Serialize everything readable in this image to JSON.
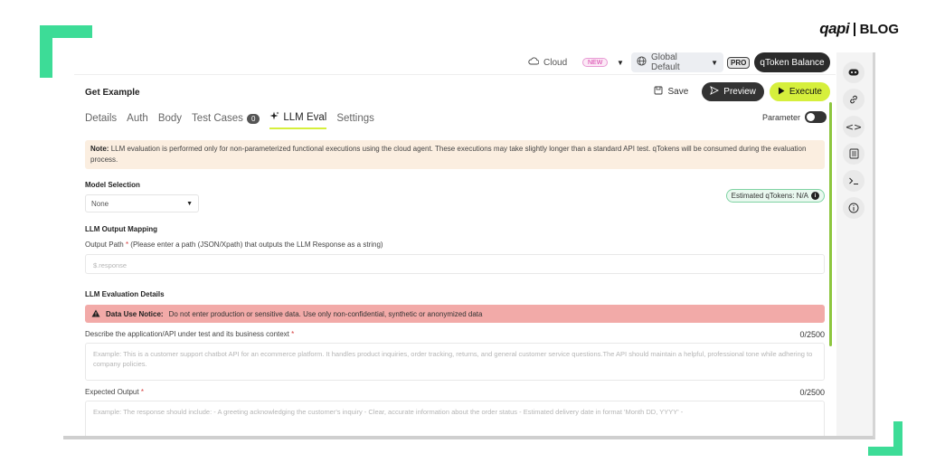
{
  "brand": {
    "logo": "qapi",
    "section": "BLOG"
  },
  "topbar": {
    "cloud_label": "Cloud",
    "new_badge": "NEW",
    "environment": "Global Default",
    "pro_badge": "PRO",
    "qtoken_button": "qToken Balance"
  },
  "header": {
    "title": "Get Example",
    "save_label": "Save",
    "preview_label": "Preview",
    "execute_label": "Execute"
  },
  "tabs": [
    {
      "label": "Details"
    },
    {
      "label": "Auth"
    },
    {
      "label": "Body"
    },
    {
      "label": "Test Cases",
      "count": "0"
    },
    {
      "label": "LLM Eval",
      "active": true
    },
    {
      "label": "Settings"
    }
  ],
  "parameter_label": "Parameter",
  "note": {
    "prefix": "Note:",
    "text": "LLM evaluation is performed only for non-parameterized functional executions using the cloud agent. These executions may take slightly longer than a standard API test. qTokens will be consumed during the evaluation process."
  },
  "model": {
    "heading": "Model Selection",
    "selected": "None",
    "estimated": "Estimated qTokens: N/A"
  },
  "output_mapping": {
    "heading": "LLM Output Mapping",
    "path_label": "Output Path",
    "required_mark": "*",
    "path_hint": "(Please enter a path (JSON/Xpath) that outputs the LLM Response as a string)",
    "path_placeholder": "$.response"
  },
  "evaluation": {
    "heading": "LLM Evaluation Details",
    "notice_prefix": "Data Use Notice:",
    "notice_text": "Do not enter production or sensitive data. Use only non-confidential, synthetic or anonymized data",
    "describe_label": "Describe the application/API under test and its business context",
    "describe_counter": "0/2500",
    "describe_placeholder": "Example: This is a customer support chatbot API for an ecommerce platform. It handles product inquiries, order tracking, returns, and general customer service questions.The API should maintain a helpful, professional tone while adhering to company policies.",
    "expected_label": "Expected Output",
    "expected_counter": "0/2500",
    "expected_placeholder": "Example: The response should include: - A greeting acknowledging the customer's inquiry - Clear, accurate information about the order status - Estimated delivery date in format 'Month DD, YYYY' -"
  },
  "colors": {
    "accent_green": "#3ddc97",
    "execute_yellow": "#d6ef3c",
    "warning_red": "#f2aaa8",
    "note_bg": "#fbeee0"
  }
}
